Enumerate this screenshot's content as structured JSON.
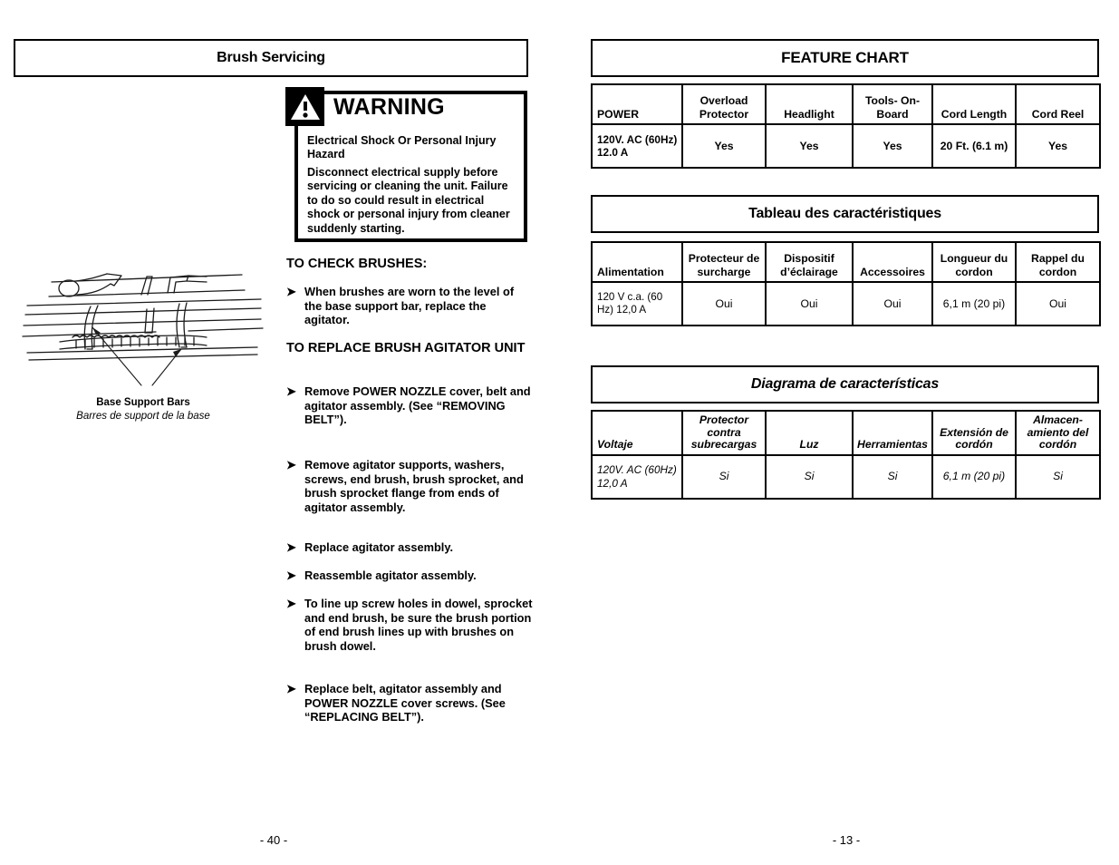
{
  "left_page": {
    "section_title": "Brush Servicing",
    "warning": {
      "icon_name": "warning-triangle-icon",
      "title": "WARNING",
      "hazard_line": "Electrical Shock Or Personal Injury Hazard",
      "body_line": "Disconnect electrical supply before servicing or cleaning the unit. Failure to do so could result in electrical shock or personal injury from cleaner suddenly starting."
    },
    "illustration": {
      "name": "base-support-bars-diagram",
      "caption_en": "Base Support Bars",
      "caption_fr": "Barres de support de la base"
    },
    "headings": {
      "check_brushes": "TO CHECK BRUSHES:",
      "replace_agitator": "TO REPLACE BRUSH AGITATOR UNIT"
    },
    "bullet_marker": "➤",
    "check_bullets": [
      "When brushes are worn to the level of the base support bar, replace the agitator."
    ],
    "replace_bullets": [
      "Remove POWER NOZZLE cover, belt and agitator assembly.  (See “REMOVING BELT”).",
      "Remove agitator supports, washers, screws, end brush, brush sprocket, and brush sprocket flange from ends of agitator assembly.",
      "Replace agitator assembly.",
      "Reassemble agitator assembly.",
      "To line up screw holes in dowel, sprocket and end brush, be sure the brush portion of end brush lines up with brushes on brush dowel.",
      "Replace belt, agitator assembly and POWER NOZZLE cover screws. (See “REPLACING BELT”)."
    ],
    "page_number": "- 40 -"
  },
  "right_page": {
    "page_number": "- 13 -",
    "tables": [
      {
        "id": "en",
        "title": "FEATURE CHART",
        "headers": [
          "POWER",
          "Overload Protector",
          "Headlight",
          "Tools- On-Board",
          "Cord Length",
          "Cord Reel"
        ],
        "values": [
          "120V. AC (60Hz) 12.0 A",
          "Yes",
          "Yes",
          "Yes",
          "20 Ft. (6.1 m)",
          "Yes"
        ]
      },
      {
        "id": "fr",
        "title": "Tableau des caractéristiques",
        "headers": [
          "Alimentation",
          "Protecteur de surcharge",
          "Dispositif d’éclairage",
          "Accessoires",
          "Longueur du cordon",
          "Rappel du cordon"
        ],
        "values": [
          "120 V c.a. (60 Hz) 12,0 A",
          "Oui",
          "Oui",
          "Oui",
          "6,1 m (20 pi)",
          "Oui"
        ]
      },
      {
        "id": "es",
        "title": "Diagrama de características",
        "headers": [
          "Voltaje",
          "Protector contra subrecargas",
          "Luz",
          "Herramientas",
          "Extensión de cordón",
          "Almacen- amiento del cordón"
        ],
        "values": [
          "120V. AC (60Hz) 12,0 A",
          "Si",
          "Si",
          "Si",
          "6,1 m (20 pi)",
          "Si"
        ]
      }
    ]
  },
  "colors": {
    "ink": "#000000",
    "paper": "#ffffff"
  }
}
